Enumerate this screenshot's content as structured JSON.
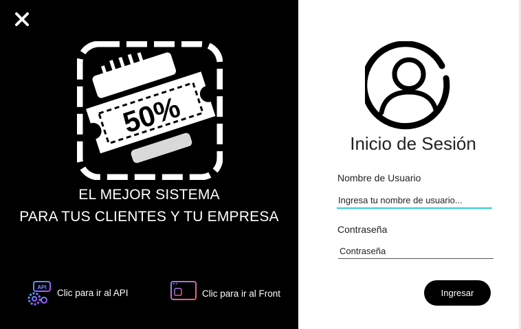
{
  "close": {
    "icon": "close-icon"
  },
  "promo": {
    "badge_text": "50%",
    "icon": "discount-ticket-icon"
  },
  "tagline": {
    "line1": "EL MEJOR SISTEMA",
    "line2": "PARA TUS CLIENTES Y TU EMPRESA"
  },
  "links": {
    "api": {
      "label": "Clic para ir al API",
      "icon": "api-gear-icon",
      "icon_text": "API"
    },
    "front": {
      "label": "Clic para ir al Front",
      "icon": "web-monitor-icon"
    }
  },
  "login": {
    "avatar_icon": "user-avatar-icon",
    "title": "Inicio de Sesión",
    "username_label": "Nombre de Usuario",
    "username_placeholder": "Ingresa tu nombre de usuario...",
    "password_label": "Contraseña",
    "password_placeholder": "Contraseña",
    "submit_label": "Ingresar"
  },
  "colors": {
    "left_bg": "#000000",
    "right_bg": "#ffffff",
    "accent": "#2ccdd8",
    "button": "#000000"
  }
}
